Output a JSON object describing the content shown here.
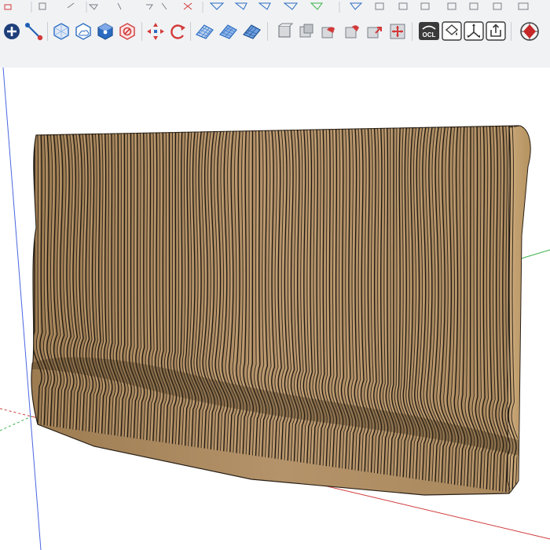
{
  "window": {
    "title": ""
  },
  "toolbar": {
    "labels": {
      "ocl_badge": "OCL"
    },
    "items": [
      {
        "name": "orbit-add-button",
        "icon": "plus-circle-icon"
      },
      {
        "name": "tape-measure-button",
        "icon": "tape-measure-icon"
      },
      {
        "name": "x-ray-button",
        "icon": "xray-cube-icon"
      },
      {
        "name": "back-edges-button",
        "icon": "back-edges-icon"
      },
      {
        "name": "shaded-button",
        "icon": "shaded-cube-icon"
      },
      {
        "name": "section-plane-button",
        "icon": "no-entry-icon"
      },
      {
        "name": "move-button",
        "icon": "move-arrows-icon"
      },
      {
        "name": "rotate-button",
        "icon": "rotate-icon"
      },
      {
        "name": "sandbox-from-contours-button",
        "icon": "mesh-grid-icon"
      },
      {
        "name": "sandbox-smoove-button",
        "icon": "mesh-smoove-icon"
      },
      {
        "name": "sandbox-stamp-button",
        "icon": "mesh-stamp-icon"
      },
      {
        "name": "solid-outer-shell-button",
        "icon": "solid-box-icon"
      },
      {
        "name": "solid-intersect-button",
        "icon": "solid-intersect-icon"
      },
      {
        "name": "solid-union-button",
        "icon": "solid-union-icon"
      },
      {
        "name": "solid-subtract-button",
        "icon": "solid-subtract-icon"
      },
      {
        "name": "solid-trim-button",
        "icon": "solid-trim-icon"
      },
      {
        "name": "solid-split-button",
        "icon": "solid-split-icon"
      },
      {
        "name": "opencutlist-button",
        "icon": "ocl-icon"
      },
      {
        "name": "paint-bucket-button",
        "icon": "paint-bucket-icon"
      },
      {
        "name": "axes-button",
        "icon": "axes-icon"
      },
      {
        "name": "export-button",
        "icon": "share-export-icon"
      },
      {
        "name": "extension-warehouse-button",
        "icon": "globe-warehouse-icon"
      }
    ]
  },
  "colors": {
    "toolbar_bg": "#f1f2f4",
    "wood_face": "#b08e62",
    "wood_highlight": "#c9a77a",
    "wood_shadow": "#6e5432",
    "slat_line": "#1c1712",
    "axis_red": "#d23a3a",
    "axis_green": "#3bb24a",
    "axis_blue": "#4a66e0",
    "accent_blue": "#1e5fb4"
  },
  "viewport": {
    "model": "parametric-slatted-bench"
  }
}
